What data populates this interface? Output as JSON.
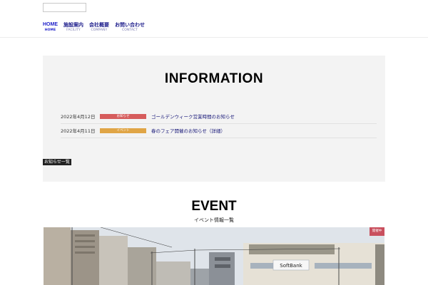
{
  "header": {
    "search": {
      "placeholder": ""
    },
    "nav": [
      {
        "jp": "HOME",
        "en": "HOME"
      },
      {
        "jp": "施設案内",
        "en": "FACILITY"
      },
      {
        "jp": "会社概要",
        "en": "COMPANY"
      },
      {
        "jp": "お問い合わせ",
        "en": "CONTACT"
      }
    ]
  },
  "information": {
    "title": "INFORMATION",
    "items": [
      {
        "date": "2022年4月12日",
        "badge": "お知らせ",
        "badge_color": "#d65c5c",
        "title": "ゴールデンウィーク営業時間のお知らせ"
      },
      {
        "date": "2022年4月11日",
        "badge": "イベント",
        "badge_color": "#e0a546",
        "title": "春のフェア開催のお知らせ（詳細）"
      }
    ],
    "more_label": "お知らせ一覧"
  },
  "event": {
    "title": "EVENT",
    "subtitle": "イベント情報一覧",
    "tag": "開催中",
    "tag_color": "#c9505e",
    "sign_text": "SoftBank"
  }
}
